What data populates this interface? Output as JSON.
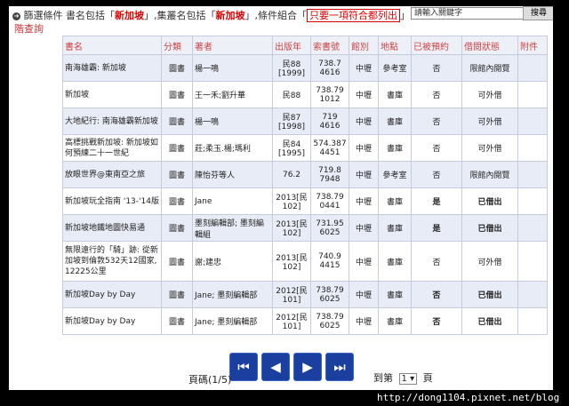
{
  "header": {
    "prefix": "篩選條件",
    "text1": "書名包括「",
    "kw1": "新加坡",
    "text2": "」,集叢名包括「",
    "kw2": "新加坡",
    "text3": "」,條件組合「",
    "mode": "只要一項符合都列出",
    "text4": "」",
    "search_placeholder": "請輸入關鍵字",
    "search_button": "搜尋",
    "subquery": "階查詢"
  },
  "table": {
    "columns": [
      "書名",
      "分類",
      "著者",
      "出版年",
      "索書號",
      "館別",
      "地點",
      "已被預約",
      "借閱狀態",
      "附件"
    ],
    "rows": [
      {
        "title": "南海雄霸: 新加坡",
        "type": "圖書",
        "author": "楊一鳴",
        "year": "民88 [1999]",
        "callno": "738.7 4616",
        "library": "中壢",
        "location": "參考室",
        "reserved": "否",
        "status": "限館內閱覽",
        "attach": ""
      },
      {
        "title": "新加坡",
        "type": "圖書",
        "author": "王一禾;劉升華",
        "year": "民88",
        "callno": "738.79 1012",
        "library": "中壢",
        "location": "書庫",
        "reserved": "否",
        "status": "可外借",
        "attach": ""
      },
      {
        "title": "大地紀行: 南海雄霸新加坡",
        "type": "圖書",
        "author": "楊一鳴",
        "year": "民87 [1998]",
        "callno": "719 4616",
        "library": "中壢",
        "location": "書庫",
        "reserved": "否",
        "status": "可外借",
        "attach": ""
      },
      {
        "title": "高標挑戰新加坡: 新加坡如何預練二十一世紀",
        "type": "圖書",
        "author": "莊;柔玉.楊;瑪利",
        "year": "民84 [1995]",
        "callno": "574.387 4451",
        "library": "中壢",
        "location": "書庫",
        "reserved": "否",
        "status": "可外借",
        "attach": ""
      },
      {
        "title": "放眼世界@東南亞之旅",
        "type": "圖書",
        "author": "陳怡芬等人",
        "year": "76.2",
        "callno": "719.8 7948",
        "library": "中壢",
        "location": "參考室",
        "reserved": "否",
        "status": "限館內閱覽",
        "attach": ""
      },
      {
        "title": "新加坡玩全指南 '13-'14版",
        "type": "圖書",
        "author": "Jane",
        "year": "2013[民102]",
        "callno": "738.79 0441",
        "library": "中壢",
        "location": "書庫",
        "reserved": "是",
        "status": "已借出",
        "attach": ""
      },
      {
        "title": "新加坡地鐵地圖快易通",
        "type": "圖書",
        "author": "墨刻編輯部; 墨刻編輯組",
        "year": "2013[民102]",
        "callno": "731.95 6025",
        "library": "中壢",
        "location": "書庫",
        "reserved": "是",
        "status": "已借出",
        "attach": ""
      },
      {
        "title": "無限遠行的「騎」跡: 從新加坡到倫敦532天12國家, 12225公里",
        "type": "圖書",
        "author": "謝;建忠",
        "year": "2013[民102]",
        "callno": "740.9 4415",
        "library": "中壢",
        "location": "書庫",
        "reserved": "否",
        "status": "可外借",
        "attach": ""
      },
      {
        "title": "新加坡Day by Day",
        "type": "圖書",
        "author": "Jane; 墨刻編輯部",
        "year": "2012[民101]",
        "callno": "738.79 6025",
        "library": "中壢",
        "location": "書庫",
        "reserved": "否",
        "status": "已借出",
        "attach": ""
      },
      {
        "title": "新加坡Day by Day",
        "type": "圖書",
        "author": "Jane; 墨刻編輯部",
        "year": "2012[民101]",
        "callno": "738.79 6025",
        "library": "中壢",
        "location": "書庫",
        "reserved": "否",
        "status": "已借出",
        "attach": ""
      }
    ]
  },
  "pager": {
    "first_icon": "first-page-icon",
    "prev_icon": "prev-page-icon",
    "next_icon": "next-page-icon",
    "last_icon": "last-page-icon",
    "page_label": "頁碼(1/5)",
    "goto_prefix": "到第",
    "goto_value": "1",
    "goto_suffix": "頁"
  },
  "watermark": "http://dong1104.pixnet.net/blog",
  "colors": {
    "accent_red": "#d00000",
    "link_red": "#c44444",
    "pager_blue": "#1a3f9e",
    "row_alt": "#e8ecf6"
  }
}
